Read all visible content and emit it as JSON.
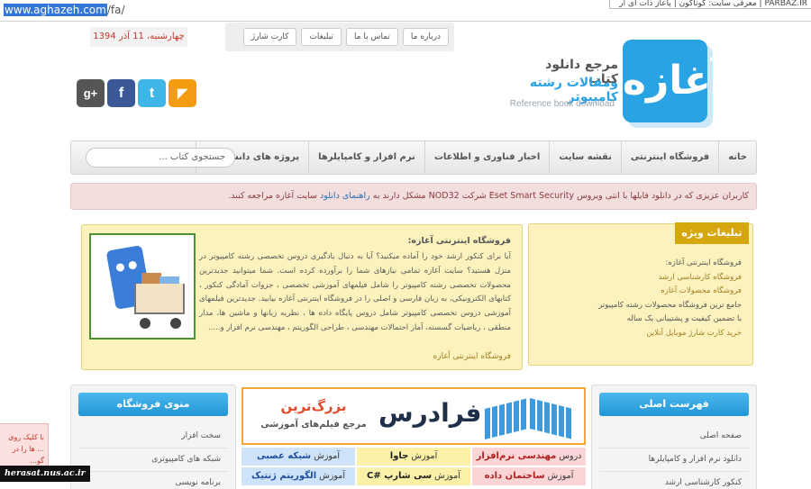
{
  "browser": {
    "url_host": "www.aghazeh.com",
    "url_path": "/fa/",
    "tab_title": "PARBAZ.IR | معرفی سایت: گوناگون | پاعاز ذات ای ار"
  },
  "header": {
    "date": "چهارشنبه، 11 آذر 1394",
    "top_nav": [
      "درباره ما",
      "تماس با ما",
      "تبلیغات",
      "کارت شارژ"
    ],
    "social": [
      {
        "icon": "google-plus-icon",
        "glyph": "g+"
      },
      {
        "icon": "facebook-icon",
        "glyph": "f"
      },
      {
        "icon": "twitter-icon",
        "glyph": "t"
      },
      {
        "icon": "rss-icon",
        "glyph": "◤"
      }
    ],
    "logo": {
      "mark": "آغازه",
      "line1": "مرجع دانلود کتاب",
      "line2": "ومقالات رشته کامپیوتر",
      "subtitle": "Reference book download"
    }
  },
  "main_nav": {
    "items": [
      "خانه",
      "فروشگاه اینترنتی",
      "نقشه سایت",
      "اخبار فناوری و اطلاعات",
      "نرم افزار و کامپایلرها",
      "پروژه های دانشجویی"
    ],
    "search_placeholder": "جستجوی کتاب ..."
  },
  "notice": {
    "text_before": "کاربران عزیزی که در دانلود فایلها با انتی ویروس Eset Smart Security شرکت NOD32 مشکل دارند به",
    "link": "راهنمای دانلود",
    "text_after": "سایت آغازه مراجعه کنند."
  },
  "ads": {
    "title": "تبلیغات ویژه",
    "lines": [
      {
        "text": "فروشگاه اینترنتی آغازه:",
        "style": "d"
      },
      {
        "text": "فروشگاه کارشناسی ارشد",
        "style": "l"
      },
      {
        "text": "فروشگاه محصولات آغازه",
        "style": "l"
      },
      {
        "text": "جامع ترین فروشگاه محصولات رشته کامپیوتر",
        "style": "d"
      },
      {
        "text": "با تضمین کیفیت و پشتیبانی یک ساله",
        "style": "d"
      },
      {
        "text": "خرید کارت شارژ موبایل آنلاین",
        "style": "l"
      }
    ]
  },
  "shop": {
    "title": "فروشگاه اینترنتی آغازه:",
    "body": "آیا برای کنکور ارشد خود را آماده میکنید؟ آیا به دنبال یادگیری دروس تخصصی رشته کامپیوتر در منزل هستید؟ سایت آغازه تمامی نیازهای شما را برآورده کرده است. شما میتوانید جدیدترین محصولات تخصصی رشته کامپیوتر را شامل فیلمهای آموزشی تخصصی ، جزوات آمادگی کنکور ، کتابهای الکترونیکی، به زبان فارسی و اصلی را در فروشگاه اینترنتی آغازه بیابید. جدیدترین فیلمهای آموزشی دروس تخصصی کامپیوتر شامل دروس پایگاه داده ها ، نظریه زبانها و ماشین ها، مدار منطقی ، ریاضیات گسسته، آمار احتمالات مهندسی ، طراحی الگوریتم ، مهندسی نرم افزار و.....",
    "link": "فروشگاه اینترنتی آغازه"
  },
  "left_column": {
    "title": "منوی فروشگاه",
    "items": [
      "سخت افزار",
      "شبکه های کامپیوتری",
      "برنامه نویسی"
    ]
  },
  "right_column": {
    "title": "فهرست اصلی",
    "items": [
      "صفحه اصلی",
      "دانلود نرم افزار و کامپایلرها",
      "کنکور کارشناسی ارشد"
    ]
  },
  "banner": {
    "brand": "فرادرس",
    "line1": "بزرگ‌ترین",
    "line2": "مرجع فیلم‌های آموزشی"
  },
  "courses": [
    [
      {
        "pre": "دروس",
        "name": "مهندسی نرم‌افزار",
        "color": "c-pink"
      },
      {
        "pre": "آموزش",
        "name": "جاوا",
        "color": "c-yel"
      },
      {
        "pre": "آموزش",
        "name": "شبکه عصبی",
        "color": "c-blue"
      }
    ],
    [
      {
        "pre": "آموزش",
        "name": "ساختمان داده",
        "color": "c-pink"
      },
      {
        "pre": "آموزش",
        "name": "سی شارپ #C",
        "color": "c-yel"
      },
      {
        "pre": "آموزش",
        "name": "الگوریتم ژنتیک",
        "color": "c-blue"
      }
    ]
  ],
  "fragments": {
    "left_note": "با کلیک روی ... ها را در گو...",
    "watermark": "herasat.nus.ac.ir"
  }
}
